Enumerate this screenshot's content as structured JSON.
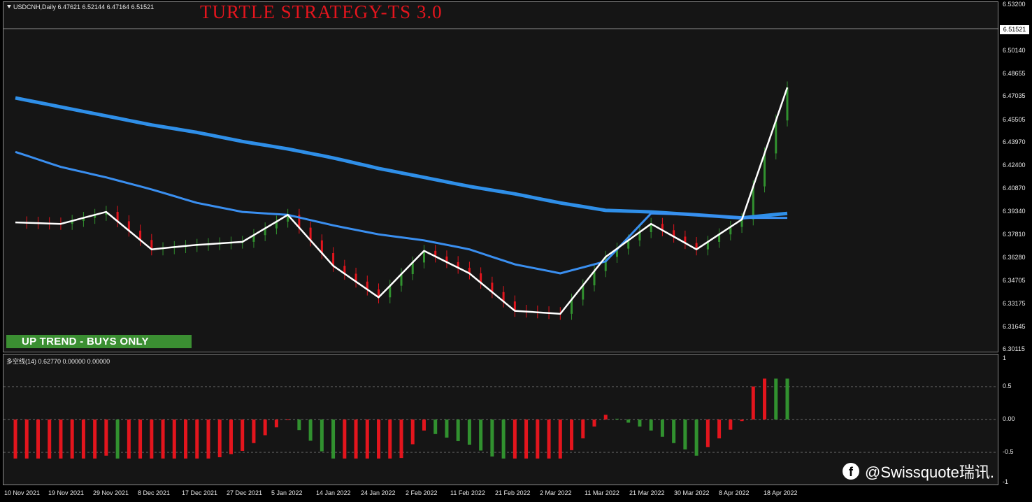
{
  "chart_header": {
    "symbol_line": "USDCNH,Daily  6.47621 6.52144 6.47164 6.51521",
    "title": "TURTLE STRATEGY-TS 3.0",
    "trend_banner": "UP TREND - BUYS ONLY"
  },
  "price_axis": {
    "ticks": [
      "6.53200",
      "6.51521",
      "6.50140",
      "6.48655",
      "6.47035",
      "6.45505",
      "6.43970",
      "6.42400",
      "6.40870",
      "6.39340",
      "6.37810",
      "6.36280",
      "6.34705",
      "6.33175",
      "6.31645",
      "6.30115"
    ],
    "current_price": "6.51521"
  },
  "indicator": {
    "label": "多空线(14) 0.62770 0.00000 0.00000",
    "ticks": [
      "1",
      "0.5",
      "0.00",
      "-0.5",
      "-1"
    ]
  },
  "date_axis": {
    "labels": [
      "10 Nov 2021",
      "19 Nov 2021",
      "29 Nov 2021",
      "8 Dec 2021",
      "17 Dec 2021",
      "27 Dec 2021",
      "5 Jan 2022",
      "14 Jan 2022",
      "24 Jan 2022",
      "2 Feb 2022",
      "11 Feb 2022",
      "21 Feb 2022",
      "2 Mar 2022",
      "11 Mar 2022",
      "21 Mar 2022",
      "30 Mar 2022",
      "8 Apr 2022",
      "18 Apr 2022"
    ]
  },
  "watermark": {
    "icon": "facebook-icon",
    "text": "@Swissquote瑞讯."
  },
  "colors": {
    "bull": "#31912f",
    "bear": "#e3151d",
    "ma_slow": "#2f8fe8",
    "ma_mid": "#3a8ff0",
    "close_line": "#ffffff",
    "channel": "#ffcc00"
  },
  "chart_data": {
    "type": "line",
    "title": "TURTLE STRATEGY-TS 3.0",
    "x": [
      "10 Nov 2021",
      "19 Nov 2021",
      "29 Nov 2021",
      "8 Dec 2021",
      "17 Dec 2021",
      "27 Dec 2021",
      "5 Jan 2022",
      "14 Jan 2022",
      "24 Jan 2022",
      "2 Feb 2022",
      "11 Feb 2022",
      "21 Feb 2022",
      "2 Mar 2022",
      "11 Mar 2022",
      "21 Mar 2022",
      "30 Mar 2022",
      "8 Apr 2022",
      "18 Apr 2022"
    ],
    "ylim": [
      6.30115,
      6.532
    ],
    "series": [
      {
        "values": [
          6.386,
          6.385,
          6.393,
          6.368,
          6.371,
          6.373,
          6.391,
          6.357,
          6.336,
          6.367,
          6.352,
          6.327,
          6.325,
          6.363,
          6.385,
          6.368,
          6.388,
          6.476
        ]
      },
      {
        "values": [
          6.433,
          6.423,
          6.416,
          6.408,
          6.399,
          6.393,
          6.391,
          6.384,
          6.378,
          6.374,
          6.368,
          6.358,
          6.352,
          6.36,
          6.392,
          6.391,
          6.389,
          6.389
        ]
      },
      {
        "values": [
          6.469,
          6.463,
          6.457,
          6.451,
          6.446,
          6.44,
          6.435,
          6.429,
          6.422,
          6.416,
          6.41,
          6.405,
          6.399,
          6.394,
          6.393,
          6.391,
          6.389,
          6.392
        ]
      }
    ]
  }
}
